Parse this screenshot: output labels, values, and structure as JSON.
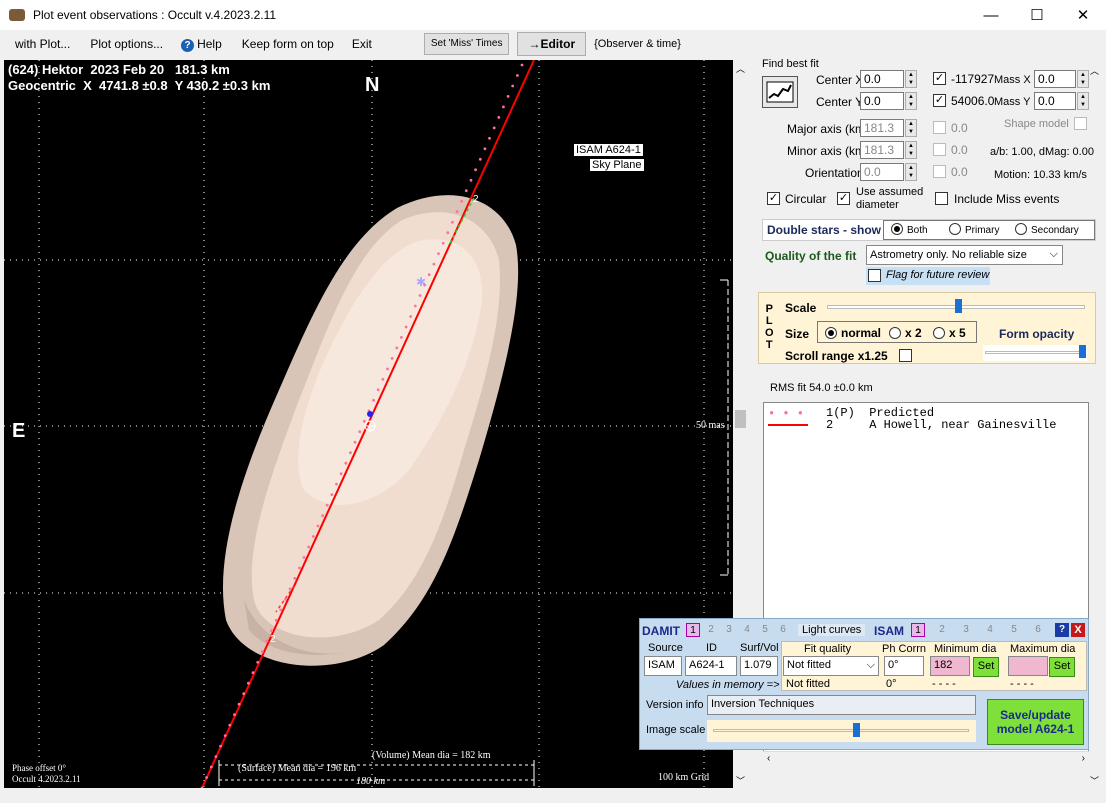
{
  "window": {
    "title": "Plot event observations : Occult v.4.2023.2.11",
    "minimize": "—",
    "maximize": "☐",
    "close": "✕"
  },
  "menu": {
    "with_plot": "with Plot...",
    "plot_options": "Plot options...",
    "help": "Help",
    "keep_on_top": "Keep form on top",
    "exit": "Exit",
    "set_miss": "Set 'Miss' Times",
    "editor": "→Editor",
    "observer_time": "{Observer & time}"
  },
  "plot": {
    "header_line1": "(624) Hektor  2023 Feb 20   181.3 km",
    "header_line2": "Geocentric  X  4741.8 ±0.8  Y 430.2 ±0.3 km",
    "north": "N",
    "east": "E",
    "model_label_1": "ISAM A624-1",
    "model_label_2": "Sky Plane",
    "scale_label": "50 mas",
    "phase_offset": "Phase offset 0°",
    "version": "Occult 4.2023.2.11",
    "volume_dia": "(Volume) Mean dia = 182 km",
    "surface_dia": "(Surface) Mean dia = 196 km",
    "km_bar": "180 km",
    "grid": "100 km Grid",
    "chord_label": "2"
  },
  "fit": {
    "find_best_fit": "Find best fit",
    "center_x_label": "Center X",
    "center_x": "0.0",
    "center_y_label": "Center Y",
    "center_y": "0.0",
    "mass_x_value": "-117927",
    "mass_x_label": "Mass X",
    "mass_x": "0.0",
    "mass_y_value": "54006.0",
    "mass_y_label": "Mass Y",
    "mass_y": "0.0",
    "major_label": "Major axis (km)",
    "major": "181.3",
    "major_dis": "0.0",
    "minor_label": "Minor axis (km)",
    "minor": "181.3",
    "minor_dis": "0.0",
    "orient_label": "Orientation",
    "orient": "0.0",
    "orient_dis": "0.0",
    "shape_model": "Shape model",
    "ab_dmag": "a/b: 1.00, dMag: 0.00",
    "motion": "Motion: 10.33 km/s",
    "circular": "Circular",
    "use_assumed": "Use assumed",
    "diameter": "diameter",
    "include_miss": "Include Miss events",
    "double_stars": "Double stars - show",
    "both": "Both",
    "primary": "Primary",
    "secondary": "Secondary",
    "quality_label": "Quality of the fit",
    "quality_value": "Astrometry only. No reliable size",
    "flag_review": "Flag for future review"
  },
  "plotpanel": {
    "p": "P",
    "l": "L",
    "o": "O",
    "t": "T",
    "scale": "Scale",
    "size": "Size",
    "normal": "normal",
    "x2": "x 2",
    "x5": "x 5",
    "form_opacity": "Form opacity",
    "scroll_range": "Scroll range x1.25"
  },
  "rms": "RMS fit 54.0 ±0.0 km",
  "legend": {
    "line1": "1(P)  Predicted",
    "line2": "2     A Howell, near Gainesville"
  },
  "damit": {
    "damit": "DAMIT",
    "tabs_damit": [
      "1",
      "2",
      "3",
      "4",
      "5",
      "6"
    ],
    "light_curves": "Light curves",
    "isam": "ISAM",
    "tabs_isam": [
      "1",
      "2",
      "3",
      "4",
      "5",
      "6"
    ],
    "source_h": "Source",
    "id_h": "ID",
    "surf_h": "Surf/Vol",
    "fitq_h": "Fit quality",
    "phcorr_h": "Ph Corrn",
    "min_h": "Minimum dia",
    "max_h": "Maximum dia",
    "source": "ISAM",
    "id": "A624-1",
    "surf": "1.079",
    "fitq": "Not fitted",
    "fitq2": "Not fitted",
    "phcorr": "0°",
    "phcorr2": "0°",
    "min": "182",
    "min2": "- - - -",
    "max2": "- - - -",
    "set": "Set",
    "values_memory": "Values in memory =>",
    "version_label": "Version info",
    "version": "Inversion Techniques",
    "image_scale": "Image scale",
    "save": "Save/update",
    "save2": "model A624-1"
  },
  "colors": {
    "accent_red": "#ff0000",
    "asteroid": "#f0ddd0",
    "damit_bg": "#c8dcf0"
  }
}
